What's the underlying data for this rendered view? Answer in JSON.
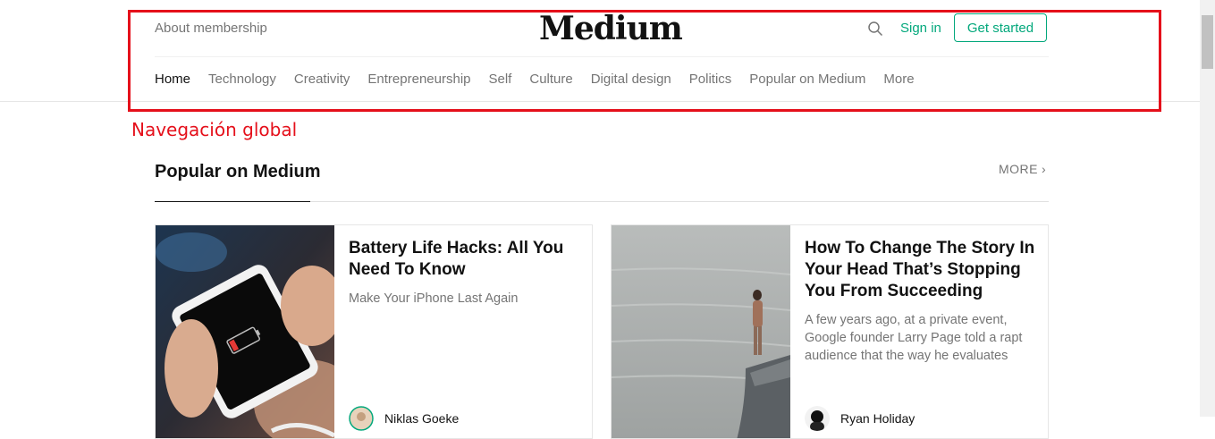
{
  "header": {
    "about_label": "About membership",
    "logo_text": "Medium",
    "signin_label": "Sign in",
    "get_started_label": "Get started"
  },
  "nav": {
    "topics": [
      "Home",
      "Technology",
      "Creativity",
      "Entrepreneurship",
      "Self",
      "Culture",
      "Digital design",
      "Politics",
      "Popular on Medium",
      "More"
    ],
    "active": "Home"
  },
  "annotation": {
    "label": "Navegación global"
  },
  "section": {
    "title": "Popular on Medium",
    "more_label": "MORE"
  },
  "cards": [
    {
      "title": "Battery Life Hacks: All You Need To Know",
      "subtitle": "Make Your iPhone Last Again",
      "author": "Niklas Goeke",
      "image": "phone-low-battery-photo"
    },
    {
      "title": "How To Change The Story In Your Head That’s Stopping You From Succeeding",
      "subtitle": "A few years ago, at a private event, Google founder Larry Page told a rapt audience that the way he evaluates",
      "author": "Ryan Holiday",
      "image": "person-standing-by-water-photo"
    }
  ],
  "colors": {
    "accent": "#03a87c",
    "annotation": "#e5101b",
    "text_muted": "#757575"
  }
}
